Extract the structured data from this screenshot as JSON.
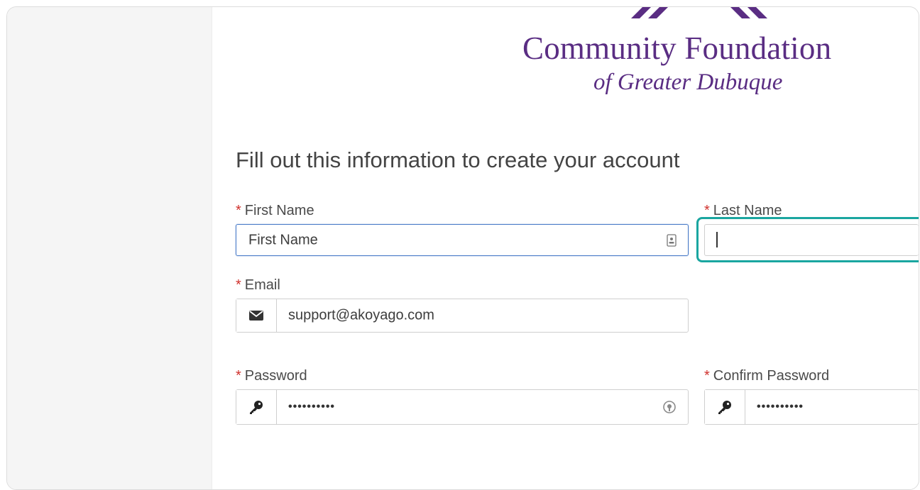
{
  "logo": {
    "line1": "Community Foundation",
    "line2": "of Greater Dubuque",
    "brand_color": "#5a2d83"
  },
  "form": {
    "title": "Fill out this information to create your account",
    "required_marker": "*",
    "first_name": {
      "label": "First Name",
      "value": "First Name",
      "icon": "contact-card-icon"
    },
    "last_name": {
      "label": "Last Name",
      "value": ""
    },
    "email": {
      "label": "Email",
      "value": "support@akoyago.com",
      "icon": "envelope-icon"
    },
    "password": {
      "label": "Password",
      "value": "••••••••••",
      "icon": "key-icon",
      "trailing_icon": "password-manager-icon"
    },
    "confirm_password": {
      "label": "Confirm Password",
      "value": "••••••••••",
      "icon": "key-icon"
    }
  },
  "colors": {
    "required": "#d0312d",
    "focus_blue": "#4a7cc8",
    "focus_teal": "#1aa6a0"
  }
}
